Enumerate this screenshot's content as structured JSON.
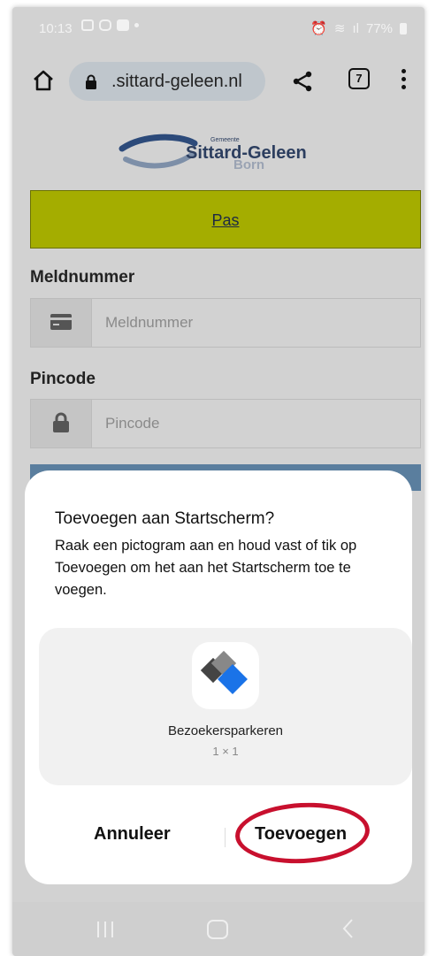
{
  "status_bar": {
    "time": "10:13",
    "battery": "77%"
  },
  "browser": {
    "url": ".sittard-geleen.nl",
    "tab_count": "7"
  },
  "logo": {
    "small_text": "Gemeente",
    "brand": "Sittard-Geleen",
    "ghost": "Born"
  },
  "page": {
    "pas_button": "Pas",
    "meldnummer_label": "Meldnummer",
    "meldnummer_placeholder": "Meldnummer",
    "pincode_label": "Pincode",
    "pincode_placeholder": "Pincode"
  },
  "dialog": {
    "title": "Toevoegen aan Startscherm?",
    "body": "Raak een pictogram aan en houd vast of tik op Toevoegen om het aan het Startscherm toe te voegen.",
    "app_name": "Bezoekersparkeren",
    "app_size": "1 × 1",
    "cancel": "Annuleer",
    "add": "Toevoegen"
  },
  "colors": {
    "pas_bg": "#a4ad00",
    "highlight_circle": "#c8102e",
    "blue_strip": "#5a7e9e"
  },
  "icons": [
    "home-icon",
    "lock-icon",
    "share-icon",
    "tabs-icon",
    "menu-icon",
    "card-icon",
    "padlock-icon",
    "app-icon",
    "recent-apps-icon",
    "home-nav-icon",
    "back-icon"
  ]
}
